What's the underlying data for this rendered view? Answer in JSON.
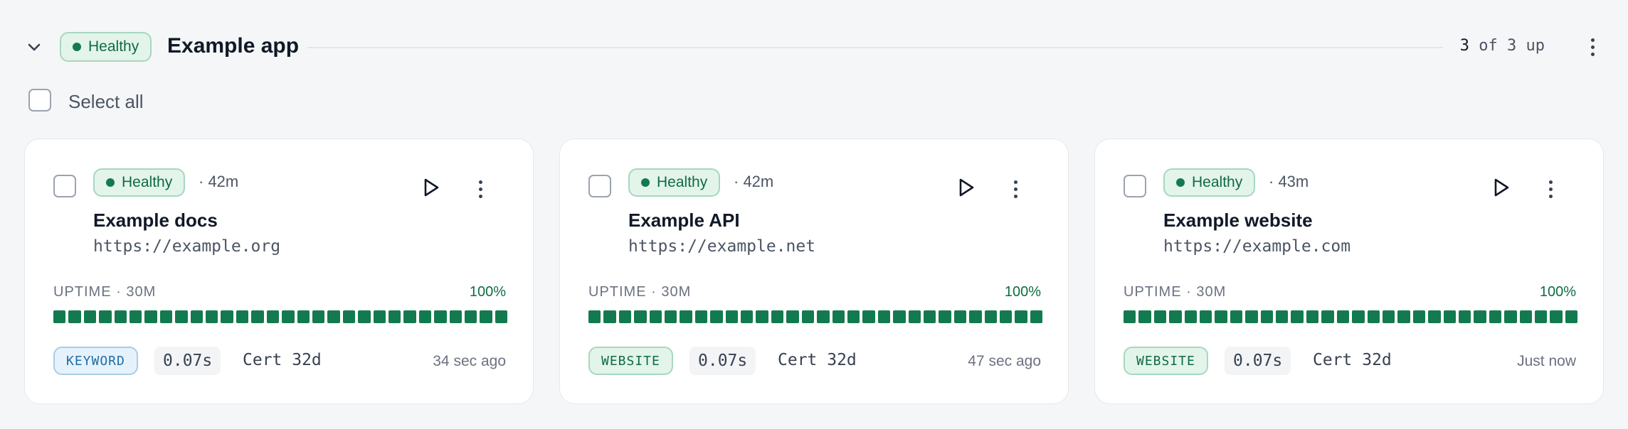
{
  "group": {
    "status": "Healthy",
    "title": "Example app",
    "up_current": "3",
    "up_rest": " of 3 up"
  },
  "select_all_label": "Select all",
  "monitors": [
    {
      "status": "Healthy",
      "age": "· 42m",
      "name": "Example docs",
      "url": "https://example.org",
      "uptime_label": "UPTIME · 30M",
      "uptime_pct": "100%",
      "uptime_fraction": 1.0,
      "type": "KEYWORD",
      "type_style": "keyword",
      "response": "0.07s",
      "cert": "Cert 32d",
      "checked": "34 sec ago"
    },
    {
      "status": "Healthy",
      "age": "· 42m",
      "name": "Example API",
      "url": "https://example.net",
      "uptime_label": "UPTIME · 30M",
      "uptime_pct": "100%",
      "uptime_fraction": 1.0,
      "type": "WEBSITE",
      "type_style": "website",
      "response": "0.07s",
      "cert": "Cert 32d",
      "checked": "47 sec ago"
    },
    {
      "status": "Healthy",
      "age": "· 43m",
      "name": "Example website",
      "url": "https://example.com",
      "uptime_label": "UPTIME · 30M",
      "uptime_pct": "100%",
      "uptime_fraction": 1.0,
      "type": "WEBSITE",
      "type_style": "website",
      "response": "0.07s",
      "cert": "Cert 32d",
      "checked": "Just now"
    }
  ],
  "colors": {
    "healthy": "#137a4f",
    "accent_text": "#0f6b43",
    "keyword_tag": "#1f6ea5"
  },
  "icons": {
    "collapse": "chevron-down-icon",
    "run": "play-icon",
    "menu": "more-vertical-icon",
    "status": "status-dot-icon"
  }
}
